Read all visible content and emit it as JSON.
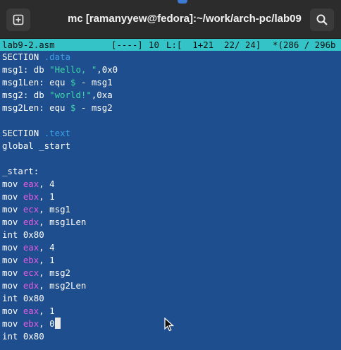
{
  "window": {
    "title": "mc [ramanyyew@fedora]:~/work/arch-pc/lab09",
    "new_tab_icon": "plus-square-icon",
    "search_icon": "search-icon"
  },
  "statusbar": {
    "filename": "lab9-2.asm",
    "flags": "[----]",
    "col": "10",
    "line_info": "L:[  1+21  22/ 24]",
    "pos": "*(286 / 296b"
  },
  "code": {
    "l1a": "SECTION ",
    "l1b": ".data",
    "l2a": "msg1: db ",
    "l2b": "\"Hello, \"",
    "l2c": ",0x0",
    "l3a": "msg1Len: equ ",
    "l3b": "$",
    "l3c": " - msg1",
    "l4a": "msg2: db ",
    "l4b": "\"world!\"",
    "l4c": ",0xa",
    "l5a": "msg2Len: equ ",
    "l5b": "$",
    "l5c": " - msg2",
    "l7a": "SECTION ",
    "l7b": ".text",
    "l8": "global _start",
    "l10": "_start:",
    "mov": "mov ",
    "eax": "eax",
    "ebx": "ebx",
    "ecx": "ecx",
    "edx": "edx",
    "v4": ", 4",
    "v1": ", 1",
    "vmsg1": ", msg1",
    "vmsg1len": ", msg1Len",
    "vmsg2": ", msg2",
    "vmsg2len": ", msg2Len",
    "v0": ", 0",
    "int": "int 0x80"
  },
  "colors": {
    "editor_bg": "#1f4e8f",
    "statusbar_bg": "#34c3c6",
    "register": "#e05ce0",
    "string": "#3fd8a8",
    "directive": "#3aa0e8"
  }
}
